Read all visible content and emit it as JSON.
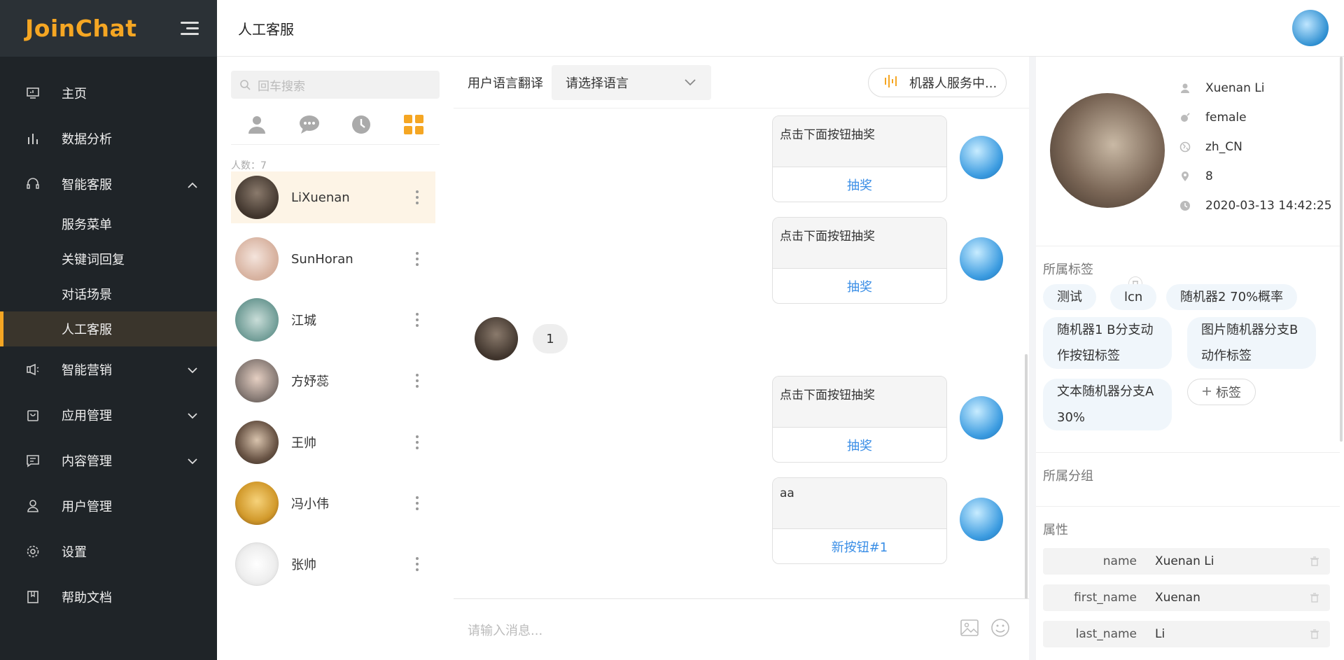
{
  "sidebar": {
    "logo": "JoinChat",
    "items": [
      {
        "label": "主页",
        "icon": "dashboard-icon"
      },
      {
        "label": "数据分析",
        "icon": "bar-chart-icon"
      },
      {
        "label": "智能客服",
        "icon": "headset-icon"
      },
      {
        "label": "智能营销",
        "icon": "megaphone-icon"
      },
      {
        "label": "应用管理",
        "icon": "bag-icon"
      },
      {
        "label": "内容管理",
        "icon": "message-square-icon"
      },
      {
        "label": "用户管理",
        "icon": "user-icon"
      },
      {
        "label": "设置",
        "icon": "gear-icon"
      },
      {
        "label": "帮助文档",
        "icon": "book-icon"
      }
    ],
    "sub_items": [
      "服务菜单",
      "关键词回复",
      "对话场景",
      "人工客服"
    ]
  },
  "header": {
    "title": "人工客服"
  },
  "contacts": {
    "search_placeholder": "回车搜索",
    "count_label": "人数：7",
    "list": [
      {
        "name": "LiXuenan"
      },
      {
        "name": "SunHoran"
      },
      {
        "name": "江城"
      },
      {
        "name": "方妤蕊"
      },
      {
        "name": "王帅"
      },
      {
        "name": "冯小伟"
      },
      {
        "name": "张帅"
      }
    ]
  },
  "chat": {
    "translate_label": "用户语言翻译",
    "language_select": "请选择语言",
    "robot_button": "机器人服务中...",
    "input_placeholder": "请输入消息...",
    "messages": [
      {
        "text": "点击下面按钮抽奖",
        "button": "抽奖"
      },
      {
        "text": "点击下面按钮抽奖",
        "button": "抽奖"
      },
      {
        "user_text": "1"
      },
      {
        "text": "点击下面按钮抽奖",
        "button": "抽奖"
      },
      {
        "text": "aa",
        "button": "新按钮#1"
      }
    ]
  },
  "profile": {
    "name": "Xuenan Li",
    "gender": "female",
    "locale": "zh_CN",
    "location": "8",
    "time": "2020-03-13 14:42:25",
    "tags_title": "所属标签",
    "tags": [
      "测试",
      "lcn",
      "随机器2 70%概率",
      "随机器1 B分支动作按钮标签",
      "图片随机器分支B动作标签",
      "文本随机器分支A 30%"
    ],
    "add_tag": "标签",
    "group_title": "所属分组",
    "attributes_title": "属性",
    "attributes": [
      {
        "key": "name",
        "value": "Xuenan Li"
      },
      {
        "key": "first_name",
        "value": "Xuenan"
      },
      {
        "key": "last_name",
        "value": "Li"
      }
    ]
  },
  "colors": {
    "accent": "#f5a623",
    "sidebar_bg": "#1f2428",
    "link": "#3a8ee6"
  }
}
